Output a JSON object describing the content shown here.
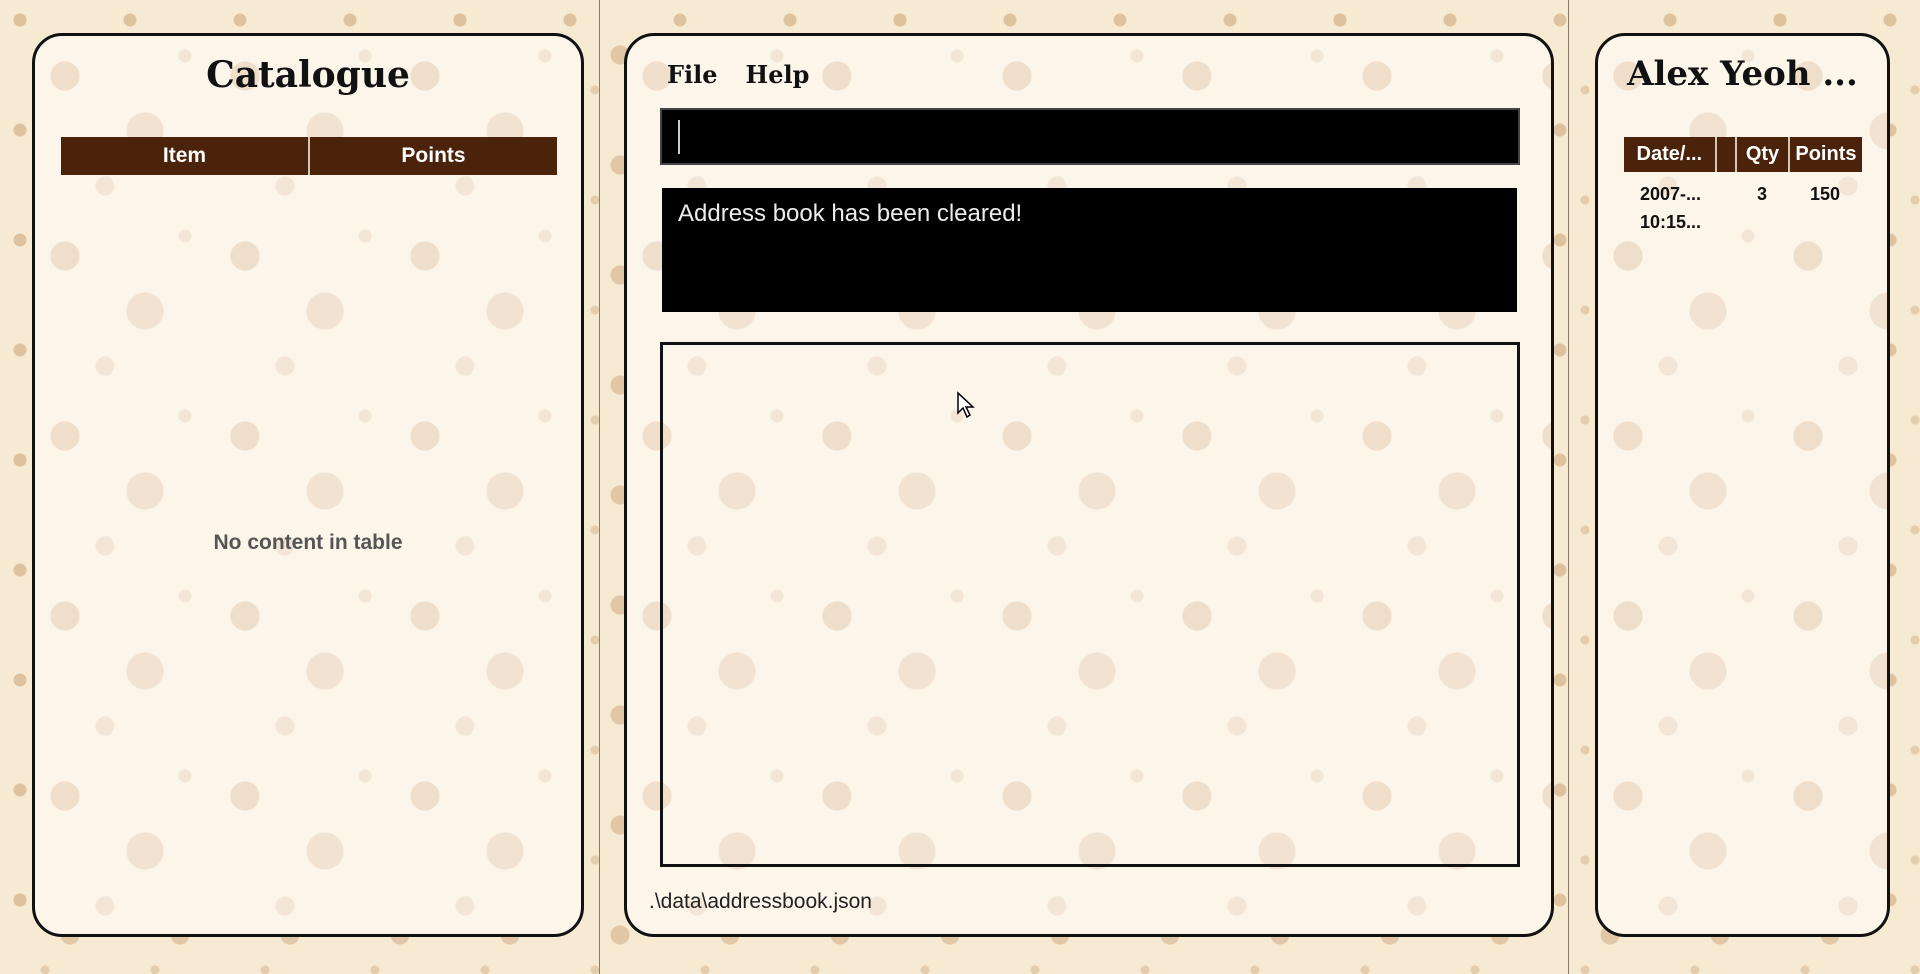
{
  "catalogue": {
    "title": "Catalogue",
    "columns": [
      "Item",
      "Points"
    ],
    "empty_message": "No content in table"
  },
  "menu": {
    "file": "File",
    "help": "Help"
  },
  "command": {
    "value": "",
    "placeholder": ""
  },
  "result": {
    "message": "Address book has been cleared!"
  },
  "status": {
    "path": ".\\data\\addressbook.json"
  },
  "customer": {
    "title": "Alex Yeoh ...",
    "columns": {
      "date": "Date/...",
      "blank": "",
      "qty": "Qty",
      "points": "Points"
    },
    "transactions": [
      {
        "date_line1": "2007-...",
        "date_line2": "10:15...",
        "qty": "3",
        "points": "150"
      }
    ]
  },
  "colors": {
    "header_bg": "#4a230a",
    "panel_bg": "#fbf5ea",
    "page_bg": "#f6ead3",
    "command_bg": "#000000"
  },
  "icons": {
    "cursor": "mouse-pointer-icon"
  }
}
